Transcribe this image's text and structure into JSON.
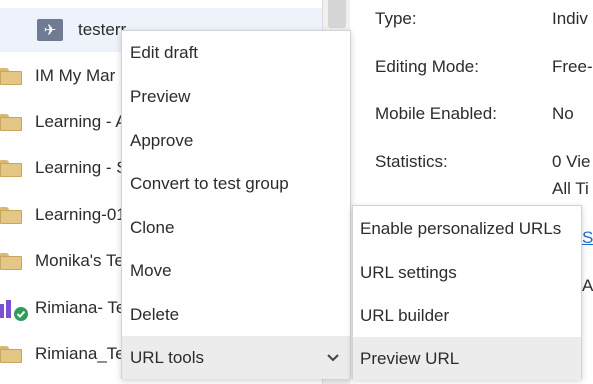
{
  "tree": {
    "items": [
      {
        "label": "testerr",
        "icon": "activity-icon"
      },
      {
        "label": "IM My Mar",
        "icon": "folder-icon"
      },
      {
        "label": "Learning - A",
        "icon": "folder-icon"
      },
      {
        "label": "Learning - S",
        "icon": "folder-icon"
      },
      {
        "label": "Learning-01",
        "icon": "folder-icon"
      },
      {
        "label": "Monika's Te",
        "icon": "folder-icon"
      },
      {
        "label": "Rimiana- Te",
        "icon": "people-icon"
      },
      {
        "label": "Rimiana_Te",
        "icon": "folder-icon"
      }
    ]
  },
  "properties": {
    "type_label": "Type:",
    "type_value": "Indiv",
    "editing_mode_label": "Editing Mode:",
    "editing_mode_value": "Free-",
    "mobile_label": "Mobile Enabled:",
    "mobile_value": "No",
    "statistics_label": "Statistics:",
    "statistics_value_1": "0 Vie",
    "statistics_value_2": "All Ti",
    "link_fragment": "Se",
    "fragment_2": "A"
  },
  "context_menu": {
    "items": [
      "Edit draft",
      "Preview",
      "Approve",
      "Convert to test group",
      "Clone",
      "Move",
      "Delete",
      "URL tools"
    ]
  },
  "url_tools_submenu": {
    "items": [
      "Enable personalized URLs",
      "URL settings",
      "URL builder",
      "Preview URL"
    ]
  },
  "colors": {
    "selected_row": "#eef2fb",
    "menu_hover": "#ececec",
    "folder": "#e5c785",
    "link": "#1a6fd1"
  }
}
